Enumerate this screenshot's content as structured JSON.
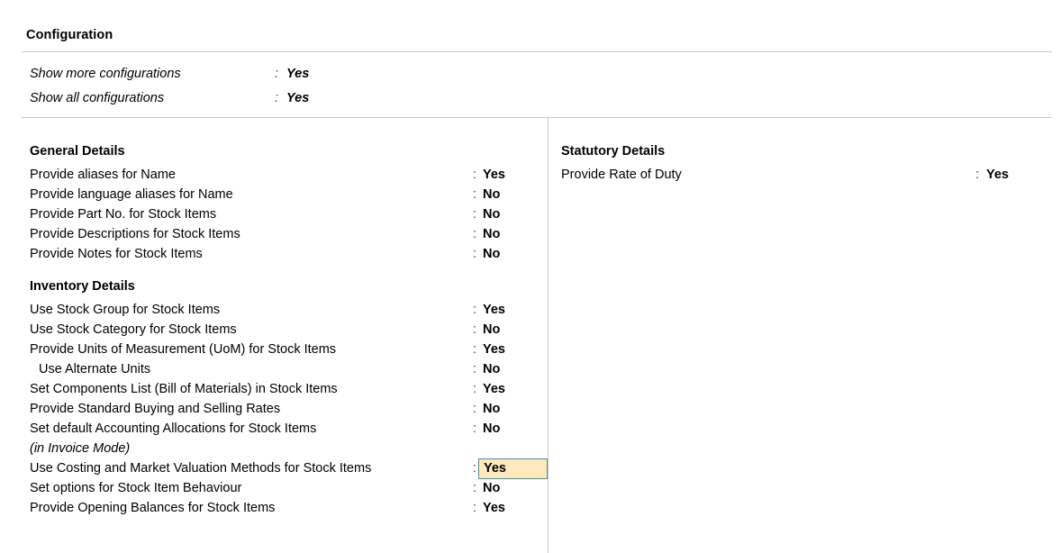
{
  "header": {
    "title": "Configuration"
  },
  "top_config": {
    "rows": [
      {
        "label": "Show more configurations",
        "colon": ":",
        "value": "Yes"
      },
      {
        "label": "Show all configurations",
        "colon": ":",
        "value": "Yes"
      }
    ]
  },
  "left_column": {
    "groups": [
      {
        "title": "General Details",
        "rows": [
          {
            "label": "Provide aliases for Name",
            "colon": ":",
            "value": "Yes",
            "focused": false,
            "indent": false,
            "note": false
          },
          {
            "label": "Provide language aliases for Name",
            "colon": ":",
            "value": "No",
            "focused": false,
            "indent": false,
            "note": false
          },
          {
            "label": "Provide Part No. for Stock Items",
            "colon": ":",
            "value": "No",
            "focused": false,
            "indent": false,
            "note": false
          },
          {
            "label": "Provide Descriptions for Stock Items",
            "colon": ":",
            "value": "No",
            "focused": false,
            "indent": false,
            "note": false
          },
          {
            "label": "Provide Notes for Stock Items",
            "colon": ":",
            "value": "No",
            "focused": false,
            "indent": false,
            "note": false
          }
        ]
      },
      {
        "title": "Inventory Details",
        "rows": [
          {
            "label": "Use Stock Group for Stock Items",
            "colon": ":",
            "value": "Yes",
            "focused": false,
            "indent": false,
            "note": false
          },
          {
            "label": "Use Stock Category for Stock Items",
            "colon": ":",
            "value": "No",
            "focused": false,
            "indent": false,
            "note": false
          },
          {
            "label": "Provide Units of Measurement (UoM) for Stock Items",
            "colon": ":",
            "value": "Yes",
            "focused": false,
            "indent": false,
            "note": false
          },
          {
            "label": "Use Alternate Units",
            "colon": ":",
            "value": "No",
            "focused": false,
            "indent": true,
            "note": false
          },
          {
            "label": "Set Components List (Bill of Materials) in Stock Items",
            "colon": ":",
            "value": "Yes",
            "focused": false,
            "indent": false,
            "note": false
          },
          {
            "label": "Provide Standard Buying and Selling Rates",
            "colon": ":",
            "value": "No",
            "focused": false,
            "indent": false,
            "note": false
          },
          {
            "label": "Set default Accounting Allocations for Stock Items",
            "colon": ":",
            "value": "No",
            "focused": false,
            "indent": false,
            "note": false
          },
          {
            "label": "(in Invoice Mode)",
            "colon": "",
            "value": "",
            "focused": false,
            "indent": false,
            "note": true
          },
          {
            "label": "Use Costing and Market Valuation Methods for Stock Items",
            "colon": ":",
            "value": "Yes",
            "focused": true,
            "indent": false,
            "note": false
          },
          {
            "label": "Set options for Stock Item Behaviour",
            "colon": ":",
            "value": "No",
            "focused": false,
            "indent": false,
            "note": false
          },
          {
            "label": "Provide Opening Balances for Stock Items",
            "colon": ":",
            "value": "Yes",
            "focused": false,
            "indent": false,
            "note": false
          }
        ]
      }
    ]
  },
  "right_column": {
    "groups": [
      {
        "title": "Statutory Details",
        "rows": [
          {
            "label": "Provide Rate of Duty",
            "colon": ":",
            "value": "Yes",
            "focused": false,
            "indent": false,
            "note": false
          }
        ]
      }
    ]
  },
  "colors": {
    "highlight_background": "#fde9bd",
    "highlight_border": "#5f8a8b",
    "rule": "#c9c9c9",
    "text": "#000000"
  }
}
